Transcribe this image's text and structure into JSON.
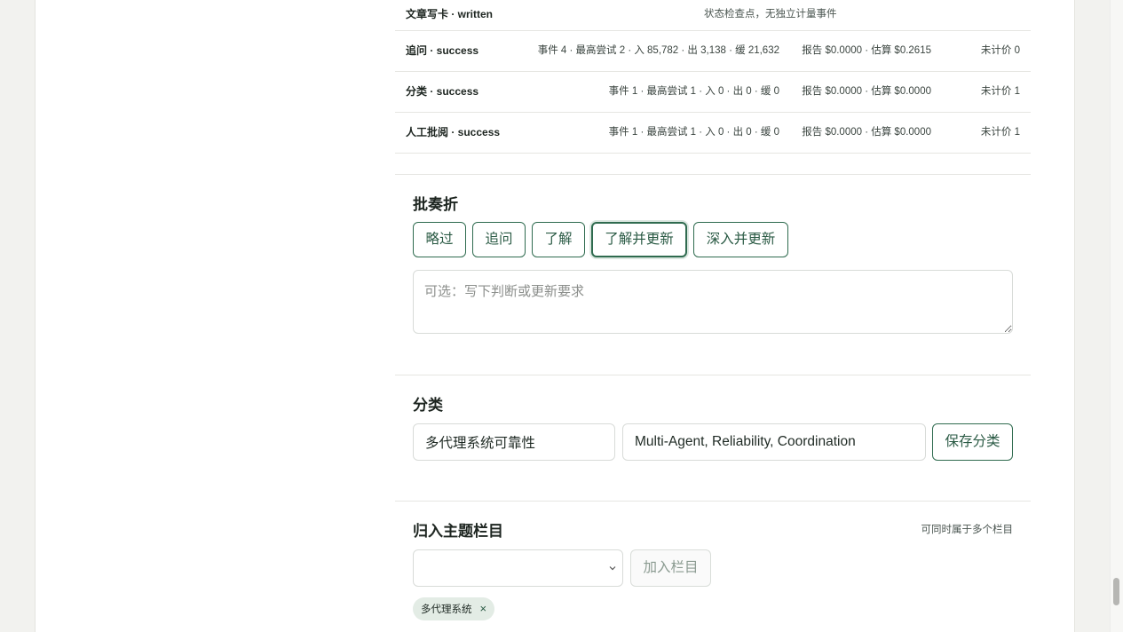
{
  "events": [
    {
      "name": "文章写卡 · written",
      "note": "状态检查点，无独立计量事件"
    },
    {
      "name": "追问 · success",
      "stats": "事件 4 · 最高尝试 2 · 入 85,782 · 出 3,138 · 缓 21,632",
      "cost": "报告 $0.0000 · 估算 $0.2615",
      "unpriced": "未计价 0"
    },
    {
      "name": "分类 · success",
      "stats": "事件 1 · 最高尝试 1 · 入 0 · 出 0 · 缓 0",
      "cost": "报告 $0.0000 · 估算 $0.0000",
      "unpriced": "未计价 1"
    },
    {
      "name": "人工批阅 · success",
      "stats": "事件 1 · 最高尝试 1 · 入 0 · 出 0 · 缓 0",
      "cost": "报告 $0.0000 · 估算 $0.0000",
      "unpriced": "未计价 1"
    }
  ],
  "review": {
    "title": "批奏折",
    "buttons": [
      "略过",
      "追问",
      "了解",
      "了解并更新",
      "深入并更新"
    ],
    "active_button": "了解并更新",
    "placeholder": "可选：写下判断或更新要求"
  },
  "classify": {
    "title": "分类",
    "category_value": "多代理系统可靠性",
    "tags_value": "Multi-Agent, Reliability, Coordination",
    "save_label": "保存分类"
  },
  "topics": {
    "title": "归入主题栏目",
    "hint": "可同时属于多个栏目",
    "select_value": "",
    "add_label": "加入栏目",
    "chips": [
      {
        "label": "多代理系统",
        "close": "×"
      }
    ]
  },
  "colors": {
    "accent": "#2f6b4f",
    "chip_bg": "#e3ece5",
    "page_bg": "#f2f2ef"
  }
}
